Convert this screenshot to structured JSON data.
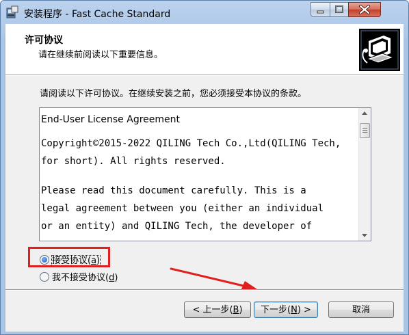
{
  "window": {
    "title": "安装程序 - Fast Cache Standard"
  },
  "header": {
    "title": "许可协议",
    "subtitle": "请在继续前阅读以下重要信息。",
    "image_icon": "setup-computer-icon"
  },
  "instruction": "请阅读以下许可协议。在继续安装之前，您必须接受本协议的条款。",
  "license": {
    "lines": [
      "End-User License Agreement",
      "Copyright©2015-2022 QILING Tech Co.,Ltd(QILING Tech,",
      "for short). All rights reserved.",
      "Please read this document carefully. This is a",
      "legal agreement between you (either an individual",
      "or an entity) and QILING Tech, the developer of"
    ]
  },
  "options": {
    "accept": {
      "label": "接受协议(",
      "key": "a",
      "close": ")",
      "checked": true
    },
    "decline": {
      "label": "我不接受协议(",
      "key": "d",
      "close": ")",
      "checked": false
    }
  },
  "buttons": {
    "back": {
      "label": "< 上一步(",
      "key": "B",
      "close": ")"
    },
    "next": {
      "label": "下一步(",
      "key": "N",
      "close": ") >"
    },
    "cancel": {
      "label": "取消"
    }
  },
  "annotation": {
    "box_color": "#e02020",
    "arrow_color": "#e02020"
  }
}
